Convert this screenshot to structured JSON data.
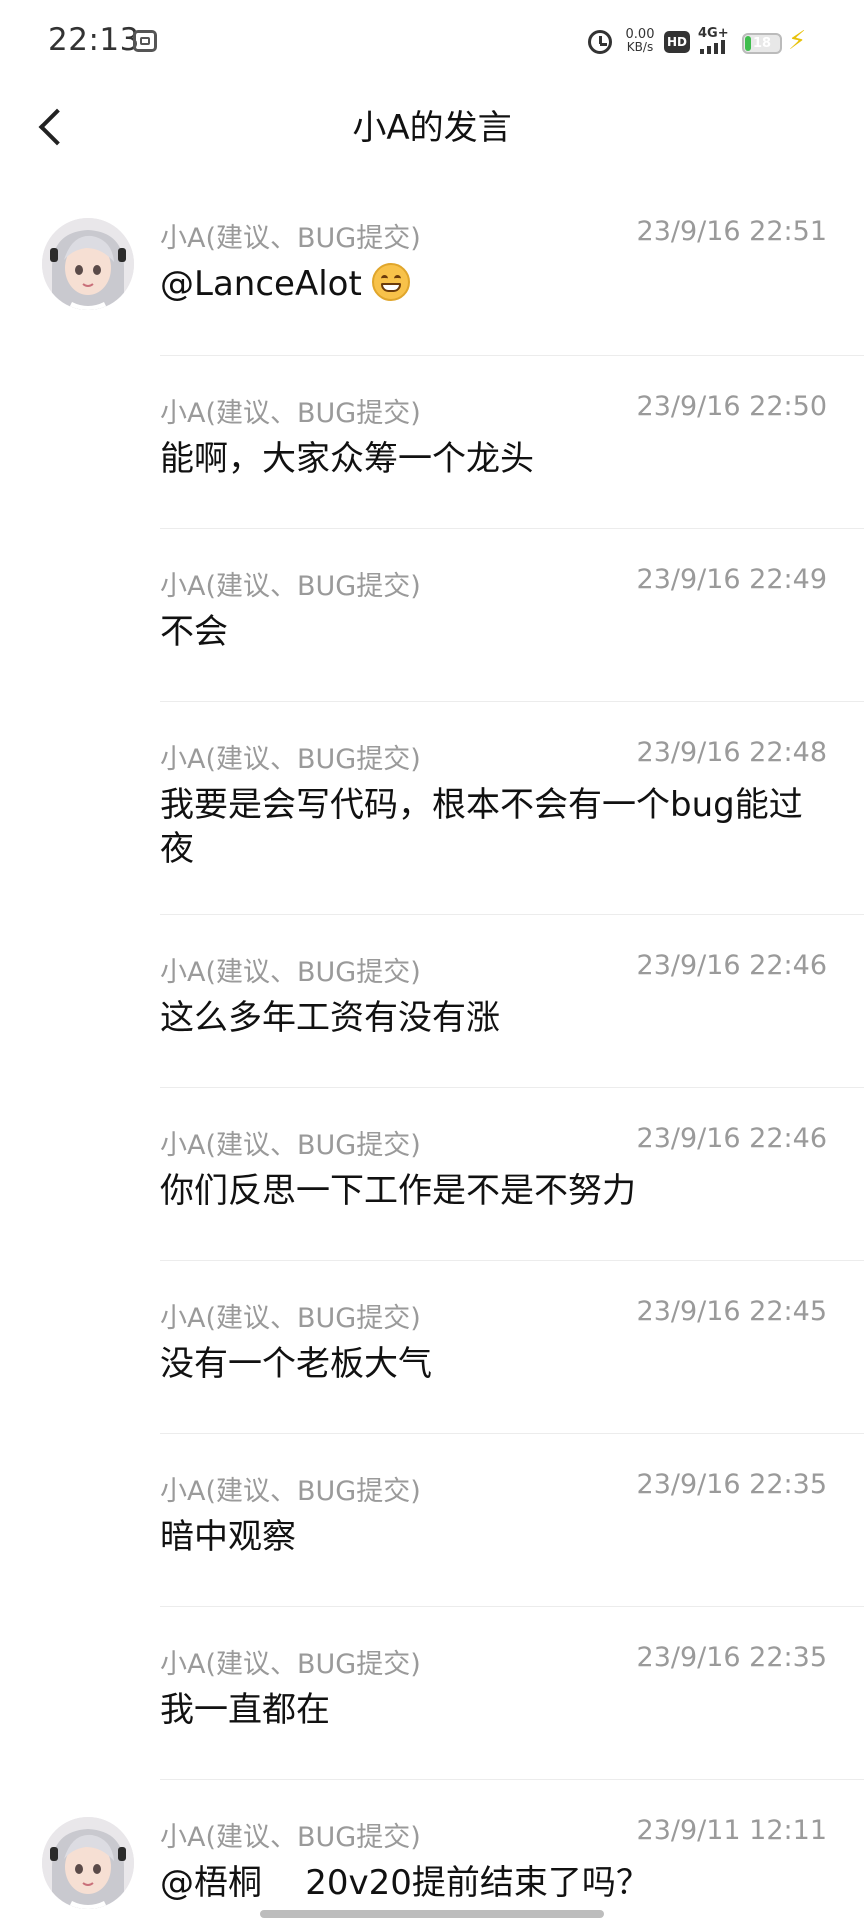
{
  "status_bar": {
    "time": "22:13",
    "net_speed_value": "0.00",
    "net_speed_unit": "KB/s",
    "hd_label": "HD",
    "network_label": "4G+",
    "battery_level": "18",
    "icons": [
      "screen-record-icon",
      "alarm-icon",
      "hd-icon",
      "signal-icon",
      "battery-icon",
      "charging-bolt-icon"
    ],
    "battery_color": "#3fbd4d"
  },
  "nav": {
    "title": "小A的发言",
    "back_icon": "chevron-left-icon"
  },
  "messages": [
    {
      "sender": "小A(建议、BUG提交)",
      "time": "23/9/16 22:51",
      "content": "@LanceAlot",
      "avatar": true,
      "emoji": "grinning-face-icon"
    },
    {
      "sender": "小A(建议、BUG提交)",
      "time": "23/9/16 22:50",
      "content": "能啊，大家众筹一个龙头",
      "avatar": false
    },
    {
      "sender": "小A(建议、BUG提交)",
      "time": "23/9/16 22:49",
      "content": "不会",
      "avatar": false
    },
    {
      "sender": "小A(建议、BUG提交)",
      "time": "23/9/16 22:48",
      "content": "我要是会写代码，根本不会有一个bug能过夜",
      "avatar": false
    },
    {
      "sender": "小A(建议、BUG提交)",
      "time": "23/9/16 22:46",
      "content": "这么多年工资有没有涨",
      "avatar": false
    },
    {
      "sender": "小A(建议、BUG提交)",
      "time": "23/9/16 22:46",
      "content": "你们反思一下工作是不是不努力",
      "avatar": false
    },
    {
      "sender": "小A(建议、BUG提交)",
      "time": "23/9/16 22:45",
      "content": "没有一个老板大气",
      "avatar": false
    },
    {
      "sender": "小A(建议、BUG提交)",
      "time": "23/9/16 22:35",
      "content": "暗中观察",
      "avatar": false
    },
    {
      "sender": "小A(建议、BUG提交)",
      "time": "23/9/16 22:35",
      "content": "我一直都在",
      "avatar": false
    },
    {
      "sender": "小A(建议、BUG提交)",
      "time": "23/9/11 12:11",
      "content": "@梧桐    20v20提前结束了吗？",
      "avatar": true
    }
  ]
}
